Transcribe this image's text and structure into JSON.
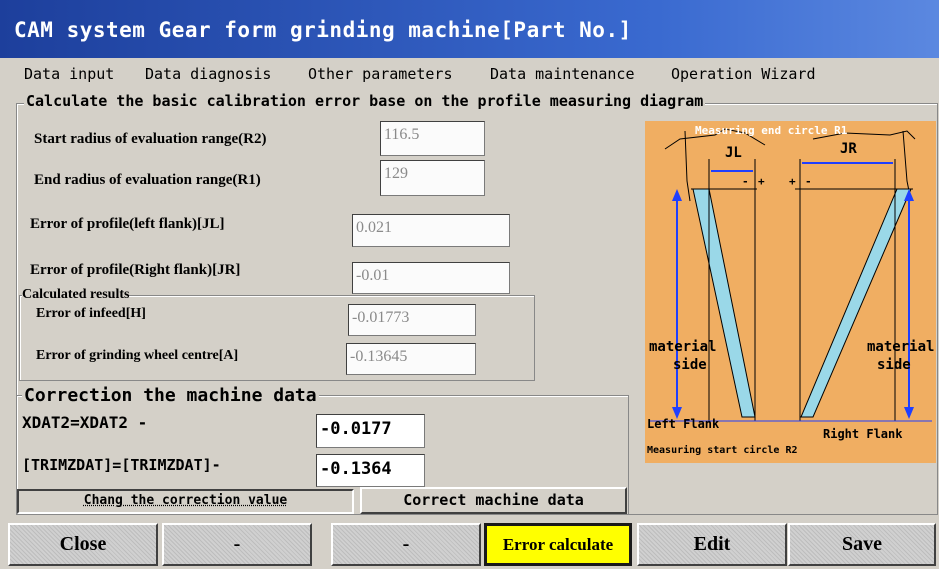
{
  "window": {
    "title": "CAM system Gear form grinding machine[Part No.]"
  },
  "menu": [
    {
      "label": "Data input"
    },
    {
      "label": "Data diagnosis"
    },
    {
      "label": "Other parameters"
    },
    {
      "label": "Data maintenance"
    },
    {
      "label": "Operation Wizard"
    }
  ],
  "main_frame": {
    "title": "Calculate the basic calibration error base on the profile measuring diagram"
  },
  "fields": {
    "start_radius": {
      "label": "Start radius of evaluation range(R2)",
      "value": "116.5"
    },
    "end_radius": {
      "label": "End radius of evaluation range(R1)",
      "value": "129"
    },
    "error_left": {
      "label": "Error of profile(left flank)[JL]",
      "value": "0.021"
    },
    "error_right": {
      "label": "Error of profile(Right flank)[JR]",
      "value": "-0.01"
    }
  },
  "results": {
    "title": "Calculated results",
    "infeed": {
      "label": "Error of  infeed[H]",
      "value": "-0.01773"
    },
    "wheel_centre": {
      "label": "Error of grinding wheel centre[A]",
      "value": "-0.13645"
    }
  },
  "correction": {
    "title": "Correction the machine data",
    "xdat_label": "XDAT2=XDAT2 -",
    "xdat_value": "-0.0177",
    "trim_label": "[TRIMZDAT]=[TRIMZDAT]-",
    "trim_value": "-0.1364",
    "change_button": "Chang the correction value",
    "correct_button": "Correct machine data"
  },
  "diagram": {
    "top_label": "Measuring end circle R1",
    "jl": "JL",
    "jr": "JR",
    "minus": "-",
    "plus": "+",
    "material_left_1": "material",
    "material_left_2": "side",
    "material_right_1": "material",
    "material_right_2": "side",
    "left_flank": "Left Flank",
    "right_flank": "Right Flank",
    "bottom_label": "Measuring start circle R2"
  },
  "bottom_buttons": [
    {
      "label": "Close"
    },
    {
      "label": "-"
    },
    {
      "label": "-"
    },
    {
      "label": "Error calculate",
      "highlight": "#ffff00"
    },
    {
      "label": "Edit"
    },
    {
      "label": "Save"
    }
  ]
}
